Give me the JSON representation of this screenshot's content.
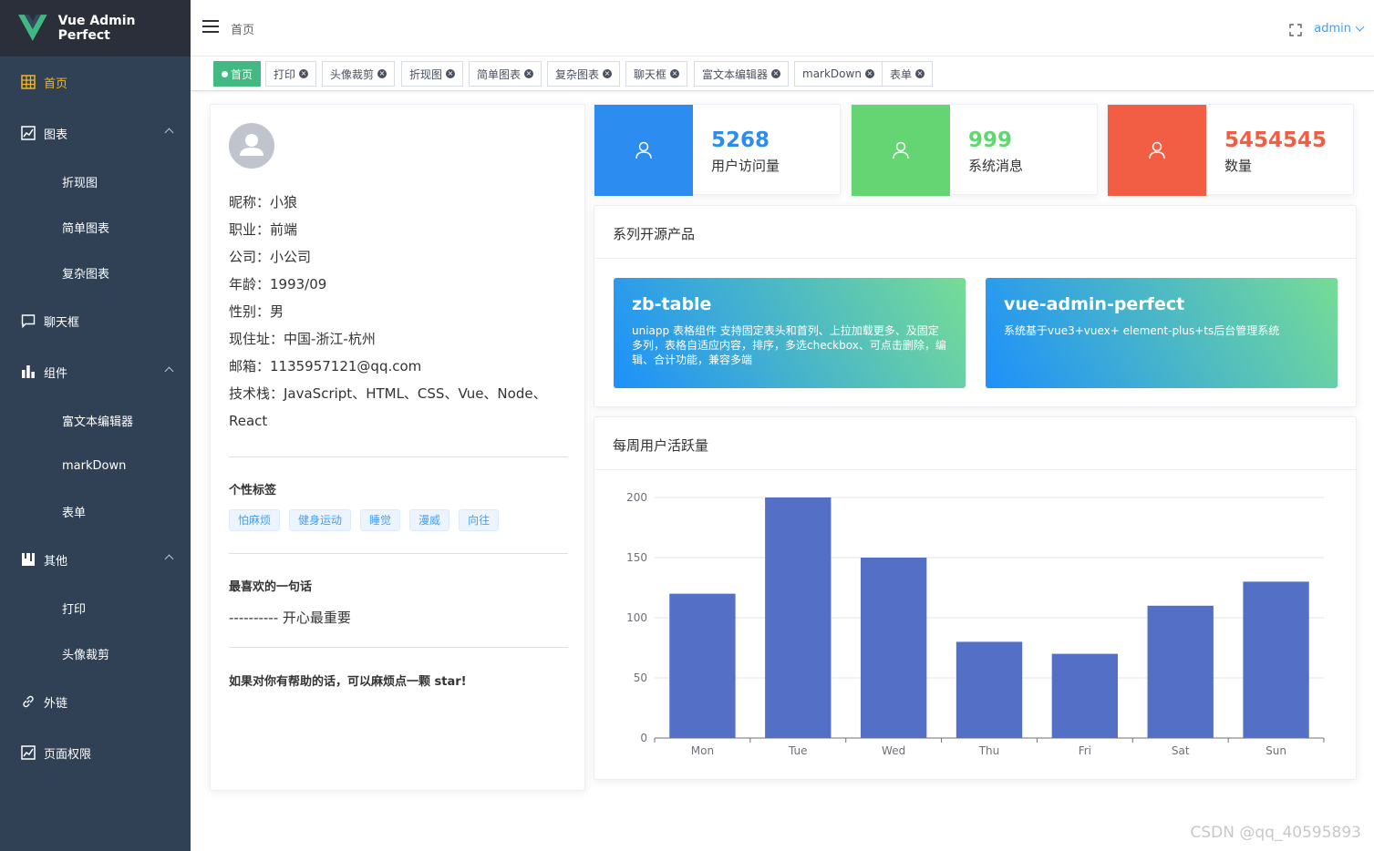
{
  "app": {
    "title": "Vue Admin Perfect"
  },
  "sidebar": {
    "items": [
      {
        "label": "首页",
        "icon": "grid-icon",
        "active": true
      },
      {
        "label": "图表",
        "icon": "line-chart-icon",
        "expanded": true,
        "children": [
          "折现图",
          "简单图表",
          "复杂图表"
        ]
      },
      {
        "label": "聊天框",
        "icon": "chat-icon"
      },
      {
        "label": "组件",
        "icon": "bar-chart-icon",
        "expanded": true,
        "children": [
          "富文本编辑器",
          "markDown",
          "表单"
        ]
      },
      {
        "label": "其他",
        "icon": "calendar-icon",
        "expanded": true,
        "children": [
          "打印",
          "头像裁剪"
        ]
      },
      {
        "label": "外链",
        "icon": "link-icon"
      },
      {
        "label": "页面权限",
        "icon": "line-chart-icon"
      }
    ]
  },
  "header": {
    "breadcrumb": "首页",
    "user": "admin"
  },
  "tags": [
    "首页",
    "打印",
    "头像裁剪",
    "折现图",
    "简单图表",
    "复杂图表",
    "聊天框",
    "富文本编辑器",
    "markDown",
    "表单"
  ],
  "profile": {
    "lines": [
      "昵称：小狼",
      "职业：前端",
      "公司：小公司",
      "年龄：1993/09",
      "性别：男",
      "现住址：中国-浙江-杭州",
      "邮箱：1135957121@qq.com",
      "技术栈：JavaScript、HTML、CSS、Vue、Node、",
      "React"
    ],
    "tags_title": "个性标签",
    "tags": [
      "怕麻烦",
      "健身运动",
      "睡觉",
      "漫威",
      "向往"
    ],
    "quote_title": "最喜欢的一句话",
    "quote": "---------- 开心最重要",
    "help": "如果对你有帮助的话，可以麻烦点一颗 star!"
  },
  "stats": [
    {
      "value": "5268",
      "label": "用户访问量",
      "color": "#2d8cf0"
    },
    {
      "value": "999",
      "label": "系统消息",
      "color": "#64d572"
    },
    {
      "value": "5454545",
      "label": "数量",
      "color": "#f25e43"
    }
  ],
  "products": {
    "title": "系列开源产品",
    "items": [
      {
        "name": "zb-table",
        "desc": "uniapp 表格组件 支持固定表头和首列、上拉加载更多、及固定多列，表格自适应内容，排序，多选checkbox、可点击删除，编辑、合计功能，兼容多端"
      },
      {
        "name": "vue-admin-perfect",
        "desc": "系统基于vue3+vuex+ element-plus+ts后台管理系统"
      }
    ]
  },
  "chart_title": "每周用户活跃量",
  "chart_data": {
    "type": "bar",
    "categories": [
      "Mon",
      "Tue",
      "Wed",
      "Thu",
      "Fri",
      "Sat",
      "Sun"
    ],
    "values": [
      120,
      200,
      150,
      80,
      70,
      110,
      130
    ],
    "ylim": [
      0,
      200
    ],
    "yticks": [
      0,
      50,
      100,
      150,
      200
    ],
    "grid": true,
    "bar_color": "#5470c6"
  },
  "watermark": "CSDN @qq_40595893"
}
